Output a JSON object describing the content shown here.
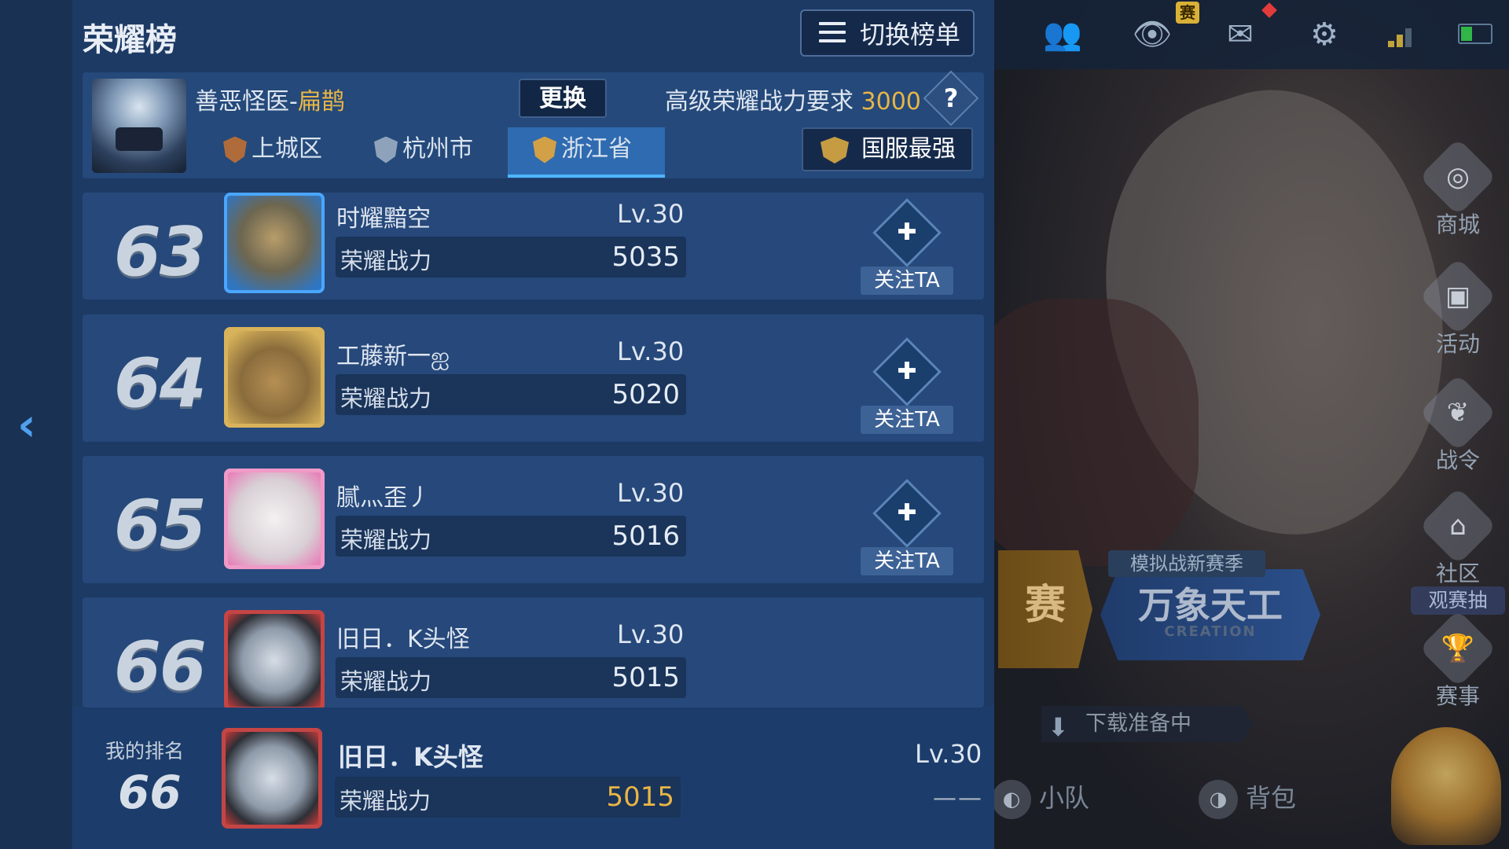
{
  "panel": {
    "title": "荣耀榜",
    "switch_label": "切换榜单"
  },
  "hero": {
    "name_prefix": "善恶怪医-",
    "name_hero": "扁鹊",
    "change_label": "更换",
    "requirement_label": "高级荣耀战力要求",
    "requirement_value": "3000",
    "help_label": "?"
  },
  "regions": {
    "tabs": [
      {
        "label": "上城区",
        "shield_color": "#b06b3a"
      },
      {
        "label": "杭州市",
        "shield_color": "#8ea3bb"
      },
      {
        "label": "浙江省",
        "shield_color": "#d2a046"
      }
    ],
    "active_index": 2,
    "national_label": "国服最强"
  },
  "ranking": {
    "power_label": "荣耀战力",
    "follow_label": "关注TA",
    "rows": [
      {
        "rank": "63",
        "name": "时耀黯空",
        "level": "Lv.30",
        "power": "5035",
        "followable": true
      },
      {
        "rank": "64",
        "name": "工藤新一ஐ",
        "level": "Lv.30",
        "power": "5020",
        "followable": true
      },
      {
        "rank": "65",
        "name": "腻灬歪丿",
        "level": "Lv.30",
        "power": "5016",
        "followable": true
      },
      {
        "rank": "66",
        "name": "旧日．K头怪",
        "level": "Lv.30",
        "power": "5015",
        "followable": false
      }
    ]
  },
  "my_rank": {
    "label": "我的排名",
    "rank": "66",
    "name": "旧日．K头怪",
    "level": "Lv.30",
    "power": "5015",
    "follow_placeholder": "——"
  },
  "background_ui": {
    "top_badge": "赛",
    "side_items": [
      "商城",
      "活动",
      "战令",
      "社区",
      "赛事"
    ],
    "live_tag": "观赛抽",
    "banner_left": "赛",
    "banner_tag": "模拟战新赛季",
    "banner_title": "万象天工",
    "banner_sub": "CREATION",
    "download_label": "下载准备中",
    "bottom_buttons": [
      "小队",
      "背包"
    ]
  },
  "colors": {
    "accent_gold": "#e9b545",
    "panel_bg": "#1d3a64",
    "row_bg": "#26487a",
    "active_tab": "#2f6bb0"
  }
}
